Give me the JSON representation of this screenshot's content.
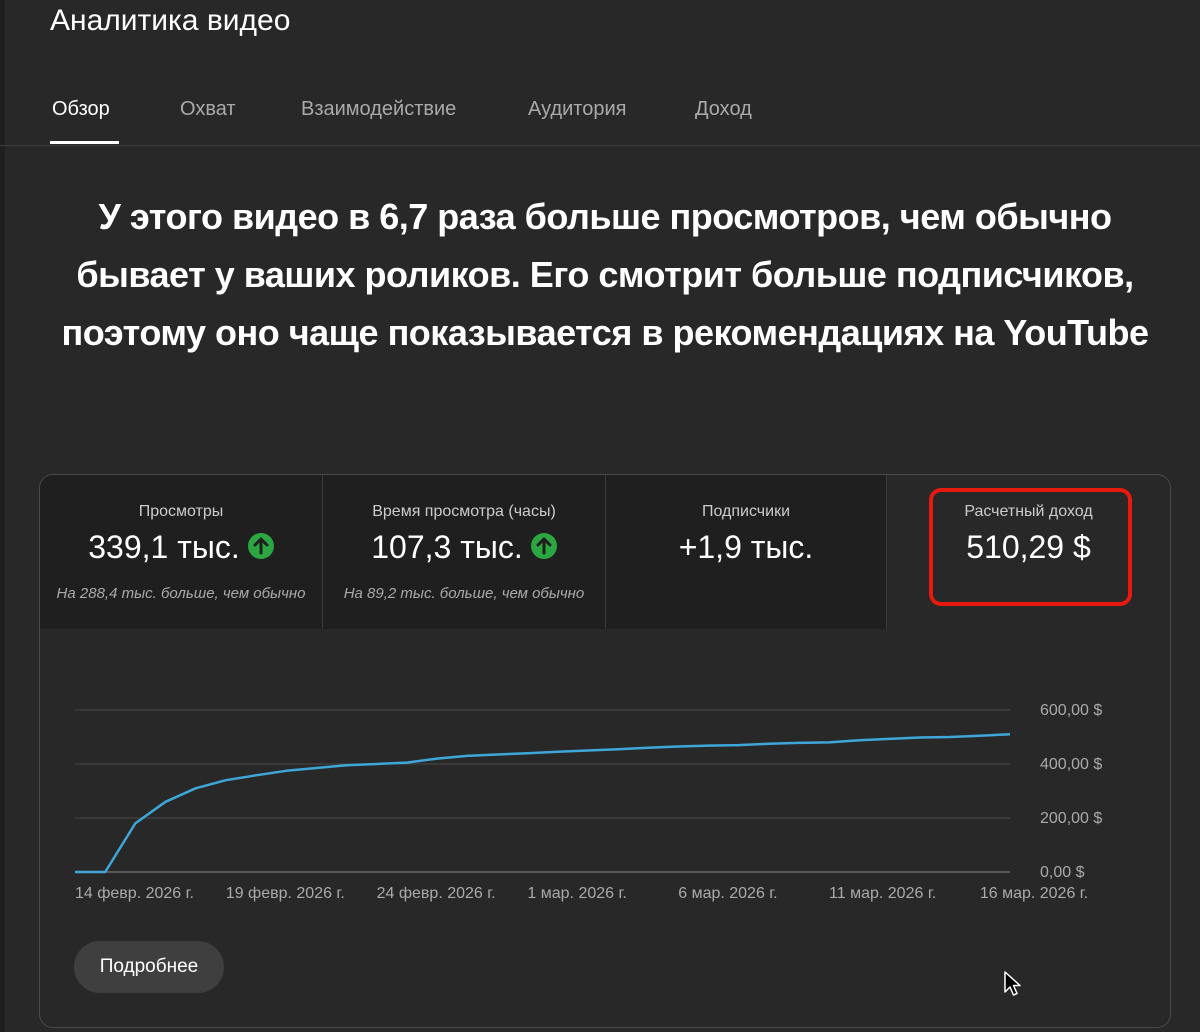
{
  "header": {
    "title": "Аналитика видео"
  },
  "tabs": [
    {
      "label": "Обзор",
      "active": true
    },
    {
      "label": "Охват"
    },
    {
      "label": "Взаимодействие"
    },
    {
      "label": "Аудитория"
    },
    {
      "label": "Доход"
    }
  ],
  "headline": "У этого видео в 6,7 раза больше просмотров, чем обычно бывает у ваших роликов. Его смотрит больше подписчиков, поэтому оно чаще показывается в рекомендациях на YouTube",
  "metrics": [
    {
      "label": "Просмотры",
      "value": "339,1 тыс.",
      "trend": "up",
      "note": "На 288,4 тыс. больше, чем обычно"
    },
    {
      "label": "Время просмотра (часы)",
      "value": "107,3 тыс.",
      "trend": "up",
      "note": "На 89,2 тыс. больше, чем обычно"
    },
    {
      "label": "Подписчики",
      "value": "+1,9 тыс."
    },
    {
      "label": "Расчетный доход",
      "value": "510,29 $",
      "highlighted": true
    }
  ],
  "colors": {
    "line": "#3ea6d9",
    "trend_up": "#2ba640",
    "highlight": "#e8190f"
  },
  "chart_data": {
    "type": "line",
    "ylim": [
      0,
      600
    ],
    "y_ticks": [
      "0,00 $",
      "200,00 $",
      "400,00 $",
      "600,00 $"
    ],
    "x_tick_labels": [
      "14 февр. 2026 г.",
      "19 февр. 2026 г.",
      "24 февр. 2026 г.",
      "1 мар. 2026 г.",
      "6 мар. 2026 г.",
      "11 мар. 2026 г.",
      "16 мар. 2026 г."
    ],
    "x_range": [
      "2026-02-14",
      "2026-03-17"
    ],
    "grid": true,
    "series": [
      {
        "x": [
          "2026-02-14",
          "2026-02-15",
          "2026-02-16",
          "2026-02-17",
          "2026-02-18",
          "2026-02-19",
          "2026-02-20",
          "2026-02-21",
          "2026-02-22",
          "2026-02-23",
          "2026-02-24",
          "2026-02-25",
          "2026-02-26",
          "2026-02-27",
          "2026-02-28",
          "2026-03-01",
          "2026-03-02",
          "2026-03-03",
          "2026-03-04",
          "2026-03-05",
          "2026-03-06",
          "2026-03-07",
          "2026-03-08",
          "2026-03-09",
          "2026-03-10",
          "2026-03-11",
          "2026-03-12",
          "2026-03-13",
          "2026-03-14",
          "2026-03-15",
          "2026-03-16",
          "2026-03-17"
        ],
        "y": [
          0,
          0,
          180,
          260,
          310,
          340,
          358,
          375,
          385,
          395,
          400,
          405,
          420,
          430,
          435,
          440,
          445,
          450,
          455,
          460,
          465,
          468,
          470,
          475,
          478,
          480,
          488,
          493,
          498,
          500,
          505,
          510
        ]
      }
    ]
  },
  "more_button": {
    "label": "Подробнее"
  }
}
